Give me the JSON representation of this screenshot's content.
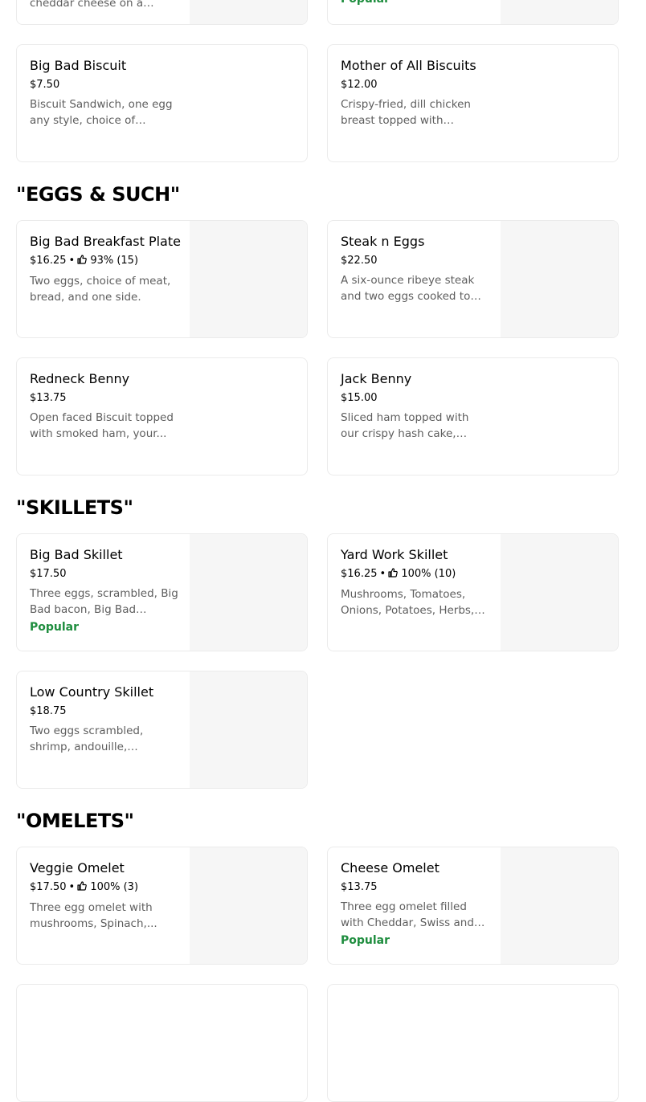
{
  "top_partial": {
    "left_desc": "cheddar cheese on a biscuit",
    "right_badge": "Popular"
  },
  "sections": {
    "eggs": "\"EGGS & SUCH\"",
    "skillets": "\"SKILLETS\"",
    "omelets": "\"OMELETS\""
  },
  "items": {
    "big_bad_biscuit": {
      "name": "Big Bad Biscuit",
      "price": "$7.50",
      "desc": "Biscuit Sandwich, one egg any style, choice of cheese..."
    },
    "mother_biscuits": {
      "name": "Mother of All Biscuits",
      "price": "$12.00",
      "desc": "Crispy-fried, dill chicken breast topped with cheddar..."
    },
    "breakfast_plate": {
      "name": "Big Bad Breakfast Plate",
      "price": "$16.25",
      "rating": "93% (15)",
      "desc": "Two eggs, choice of meat, bread, and one side."
    },
    "steak_eggs": {
      "name": "Steak n Eggs",
      "price": "$22.50",
      "desc": "A six-ounce ribeye steak and two eggs cooked to order..."
    },
    "redneck_benny": {
      "name": "Redneck Benny",
      "price": "$13.75",
      "desc": "Open faced Biscuit topped with smoked ham, your..."
    },
    "jack_benny": {
      "name": "Jack Benny",
      "price": "$15.00",
      "desc": "Sliced ham topped with our crispy hash cake, wilted..."
    },
    "big_bad_skillet": {
      "name": "Big Bad Skillet",
      "price": "$17.50",
      "desc": "Three eggs, scrambled, Big Bad bacon, Big Bad sausag...",
      "badge": "Popular"
    },
    "yard_work_skillet": {
      "name": "Yard Work Skillet",
      "price": "$16.25",
      "rating": "100% (10)",
      "desc": "Mushrooms, Tomatoes, Onions, Potatoes, Herbs, Be..."
    },
    "low_country_skillet": {
      "name": "Low Country Skillet",
      "price": "$18.75",
      "desc": "Two eggs scrambled, shrimp, andouille, cheddar..."
    },
    "veggie_omelet": {
      "name": "Veggie Omelet",
      "price": "$17.50",
      "rating": "100% (3)",
      "desc": "Three egg omelet with mushrooms, Spinach,..."
    },
    "cheese_omelet": {
      "name": "Cheese Omelet",
      "price": "$13.75",
      "desc": "Three egg omelet filled with Cheddar, Swiss and Goat...",
      "badge": "Popular"
    }
  },
  "bullet": "•",
  "colors": {
    "popular": "#1e8d3e",
    "desc": "#5e5e5e",
    "image_bg": "#f6f6f6",
    "border": "#ebebeb"
  }
}
